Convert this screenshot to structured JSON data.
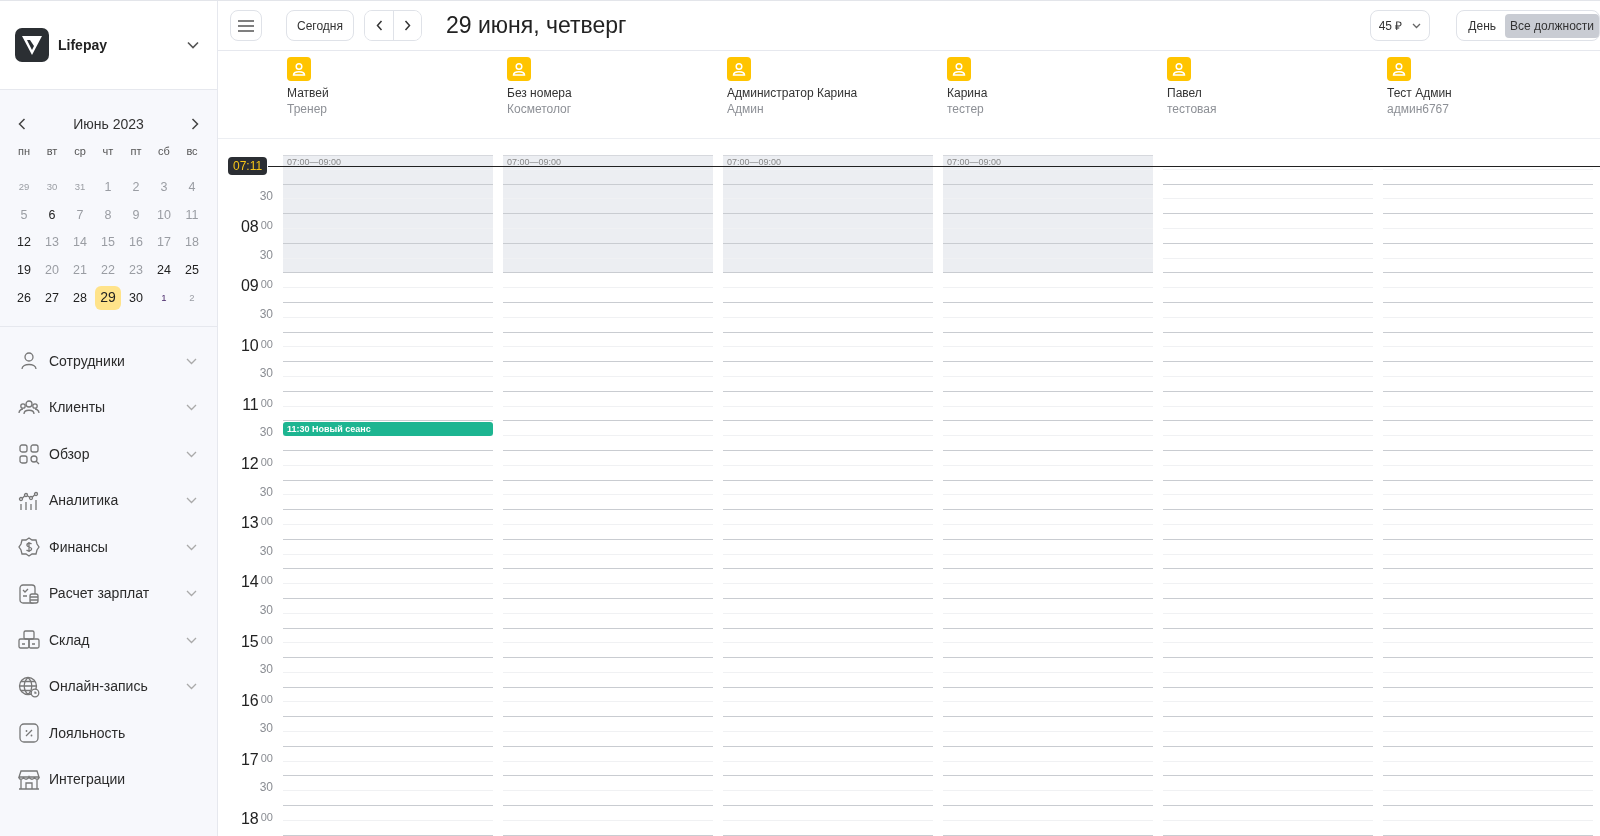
{
  "brand": {
    "name": "Lifepay"
  },
  "mini_calendar": {
    "title": "Июнь 2023",
    "weekdays": [
      "пн",
      "вт",
      "ср",
      "чт",
      "пт",
      "сб",
      "вс"
    ],
    "days": [
      {
        "label": "29",
        "kind": "other",
        "muted": true,
        "selected": false
      },
      {
        "label": "30",
        "kind": "other",
        "muted": true,
        "selected": false
      },
      {
        "label": "31",
        "kind": "other",
        "muted": true,
        "selected": false
      },
      {
        "label": "1",
        "kind": "day",
        "muted": true,
        "selected": false
      },
      {
        "label": "2",
        "kind": "day",
        "muted": true,
        "selected": false
      },
      {
        "label": "3",
        "kind": "day",
        "muted": true,
        "selected": false
      },
      {
        "label": "4",
        "kind": "day",
        "muted": true,
        "selected": false
      },
      {
        "label": "5",
        "kind": "day",
        "muted": true,
        "selected": false
      },
      {
        "label": "6",
        "kind": "day",
        "muted": false,
        "selected": false
      },
      {
        "label": "7",
        "kind": "day",
        "muted": true,
        "selected": false
      },
      {
        "label": "8",
        "kind": "day",
        "muted": true,
        "selected": false
      },
      {
        "label": "9",
        "kind": "day",
        "muted": true,
        "selected": false
      },
      {
        "label": "10",
        "kind": "day",
        "muted": true,
        "selected": false
      },
      {
        "label": "11",
        "kind": "day",
        "muted": true,
        "selected": false
      },
      {
        "label": "12",
        "kind": "day",
        "muted": false,
        "selected": false
      },
      {
        "label": "13",
        "kind": "day",
        "muted": true,
        "selected": false
      },
      {
        "label": "14",
        "kind": "day",
        "muted": true,
        "selected": false
      },
      {
        "label": "15",
        "kind": "day",
        "muted": true,
        "selected": false
      },
      {
        "label": "16",
        "kind": "day",
        "muted": true,
        "selected": false
      },
      {
        "label": "17",
        "kind": "day",
        "muted": true,
        "selected": false
      },
      {
        "label": "18",
        "kind": "day",
        "muted": true,
        "selected": false
      },
      {
        "label": "19",
        "kind": "day",
        "muted": false,
        "selected": false
      },
      {
        "label": "20",
        "kind": "day",
        "muted": true,
        "selected": false
      },
      {
        "label": "21",
        "kind": "day",
        "muted": true,
        "selected": false
      },
      {
        "label": "22",
        "kind": "day",
        "muted": true,
        "selected": false
      },
      {
        "label": "23",
        "kind": "day",
        "muted": true,
        "selected": false
      },
      {
        "label": "24",
        "kind": "day",
        "muted": false,
        "selected": false
      },
      {
        "label": "25",
        "kind": "day",
        "muted": false,
        "selected": false
      },
      {
        "label": "26",
        "kind": "day",
        "muted": false,
        "selected": false
      },
      {
        "label": "27",
        "kind": "day",
        "muted": false,
        "selected": false
      },
      {
        "label": "28",
        "kind": "day",
        "muted": false,
        "selected": false
      },
      {
        "label": "29",
        "kind": "day",
        "muted": false,
        "selected": true
      },
      {
        "label": "30",
        "kind": "day",
        "muted": false,
        "selected": false
      },
      {
        "label": "1",
        "kind": "other",
        "muted": false,
        "selected": false
      },
      {
        "label": "2",
        "kind": "other",
        "muted": true,
        "selected": false
      }
    ]
  },
  "nav": [
    {
      "label": "Сотрудники",
      "expandable": true
    },
    {
      "label": "Клиенты",
      "expandable": true
    },
    {
      "label": "Обзор",
      "expandable": true
    },
    {
      "label": "Аналитика",
      "expandable": true
    },
    {
      "label": "Финансы",
      "expandable": true
    },
    {
      "label": "Расчет зарплат",
      "expandable": true
    },
    {
      "label": "Склад",
      "expandable": true
    },
    {
      "label": "Онлайн-запись",
      "expandable": true
    },
    {
      "label": "Лояльность",
      "expandable": false
    },
    {
      "label": "Интеграции",
      "expandable": false
    }
  ],
  "toolbar": {
    "today": "Сегодня",
    "title": "29 июня, четверг",
    "price": "45 ₽",
    "views": [
      {
        "label": "День",
        "selected": false
      },
      {
        "label": "Все должности",
        "selected": true
      }
    ]
  },
  "current_time": {
    "label": "07:11"
  },
  "time_axis": [
    {
      "minutes": "30"
    },
    {
      "hour": "08",
      "minutes": "00"
    },
    {
      "minutes": "30"
    },
    {
      "hour": "09",
      "minutes": "00"
    },
    {
      "minutes": "30"
    },
    {
      "hour": "10",
      "minutes": "00"
    },
    {
      "minutes": "30"
    },
    {
      "hour": "11",
      "minutes": "00"
    },
    {
      "minutes": "30"
    },
    {
      "hour": "12",
      "minutes": "00"
    },
    {
      "minutes": "30"
    },
    {
      "hour": "13",
      "minutes": "00"
    },
    {
      "minutes": "30"
    },
    {
      "hour": "14",
      "minutes": "00"
    },
    {
      "minutes": "30"
    },
    {
      "hour": "15",
      "minutes": "00"
    },
    {
      "minutes": "30"
    },
    {
      "hour": "16",
      "minutes": "00"
    },
    {
      "minutes": "30"
    },
    {
      "hour": "17",
      "minutes": "00"
    },
    {
      "minutes": "30"
    },
    {
      "hour": "18",
      "minutes": "00"
    }
  ],
  "staff": [
    {
      "name": "Матвей",
      "role": "Тренер",
      "availability": "07:00—09:00",
      "events": [
        {
          "label": "11:30 Новый сеанс",
          "color": "#1db591"
        }
      ]
    },
    {
      "name": "Без номера",
      "role": "Косметолог",
      "availability": "07:00—09:00"
    },
    {
      "name": "Администратор Карина",
      "role": "Админ",
      "availability": "07:00—09:00"
    },
    {
      "name": "Карина",
      "role": "тестер",
      "availability": "07:00—09:00"
    },
    {
      "name": "Павел",
      "role": "тестовая"
    },
    {
      "name": "Тест Админ",
      "role": "админ6767"
    }
  ]
}
